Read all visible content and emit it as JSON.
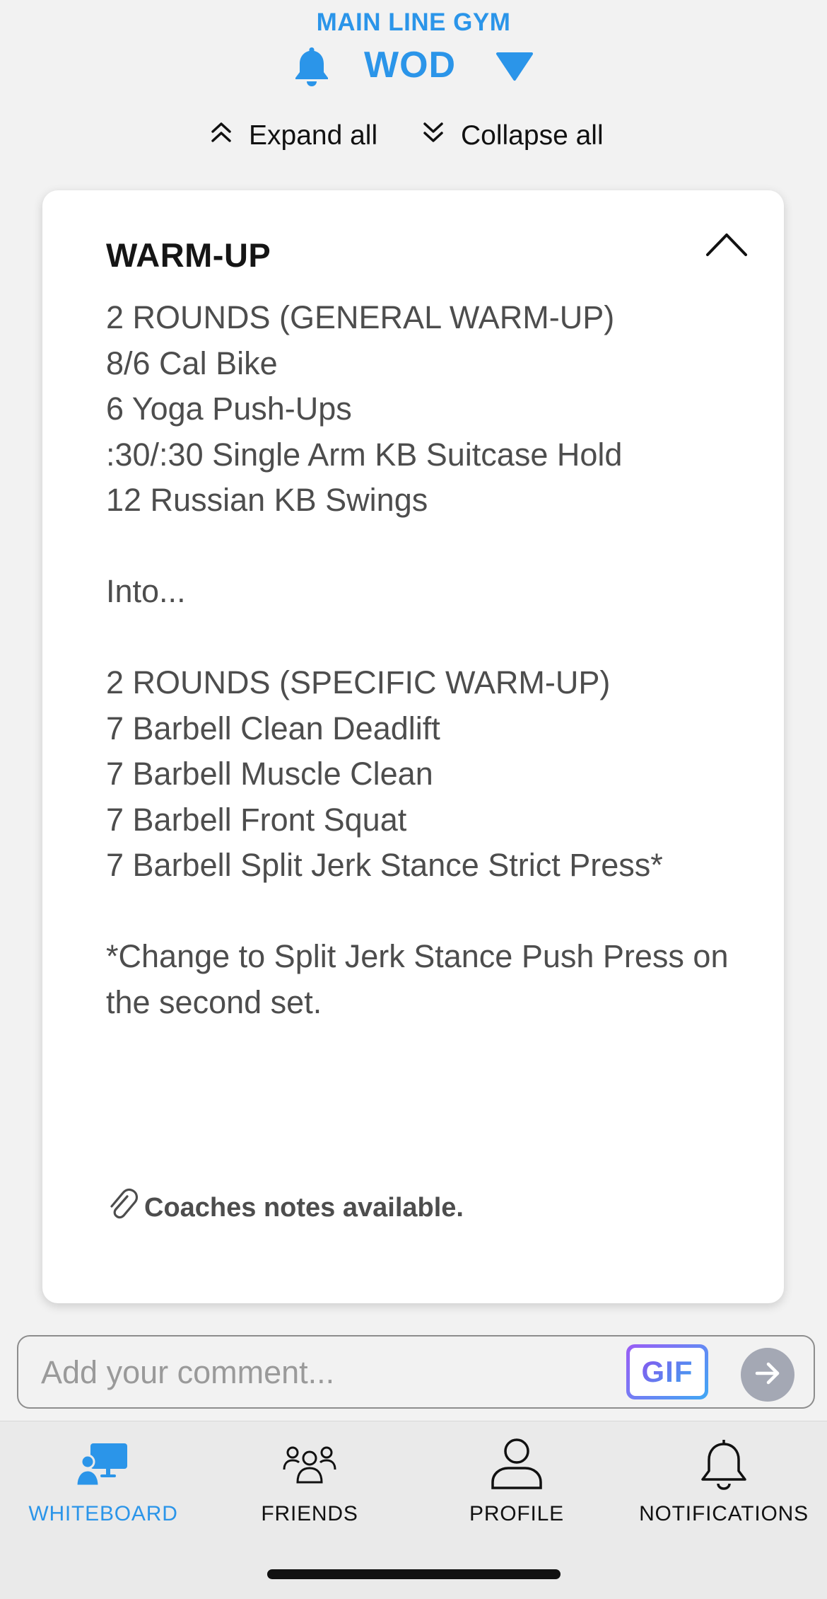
{
  "header": {
    "gym_name": "MAIN LINE GYM",
    "title": "WOD",
    "bell_icon": "bell-icon",
    "dropdown_icon": "triangle-down-icon",
    "expand_all": "Expand all",
    "collapse_all": "Collapse all",
    "accent_color": "#2b95e9"
  },
  "card": {
    "title": "WARM-UP",
    "collapse_icon": "chevron-up-icon",
    "lines": [
      "2 ROUNDS (GENERAL WARM-UP)",
      "8/6 Cal Bike",
      "6 Yoga Push-Ups",
      ":30/:30 Single Arm KB Suitcase Hold",
      "12 Russian KB Swings",
      "",
      "Into...",
      "",
      "2 ROUNDS (SPECIFIC WARM-UP)",
      "7 Barbell Clean Deadlift",
      "7 Barbell Muscle Clean",
      "7 Barbell Front Squat",
      "7 Barbell Split Jerk Stance Strict Press*",
      "",
      "*Change to Split Jerk Stance Push Press on the second set."
    ],
    "notes_label": "Coaches notes available.",
    "notes_icon": "paperclip-icon"
  },
  "comment": {
    "placeholder": "Add your comment...",
    "value": "",
    "gif_label": "GIF",
    "send_icon": "arrow-right-icon"
  },
  "tabs": [
    {
      "label": "WHITEBOARD",
      "icon": "whiteboard-icon",
      "active": true
    },
    {
      "label": "FRIENDS",
      "icon": "friends-icon",
      "active": false
    },
    {
      "label": "PROFILE",
      "icon": "profile-icon",
      "active": false
    },
    {
      "label": "NOTIFICATIONS",
      "icon": "bell-icon",
      "active": false
    }
  ]
}
